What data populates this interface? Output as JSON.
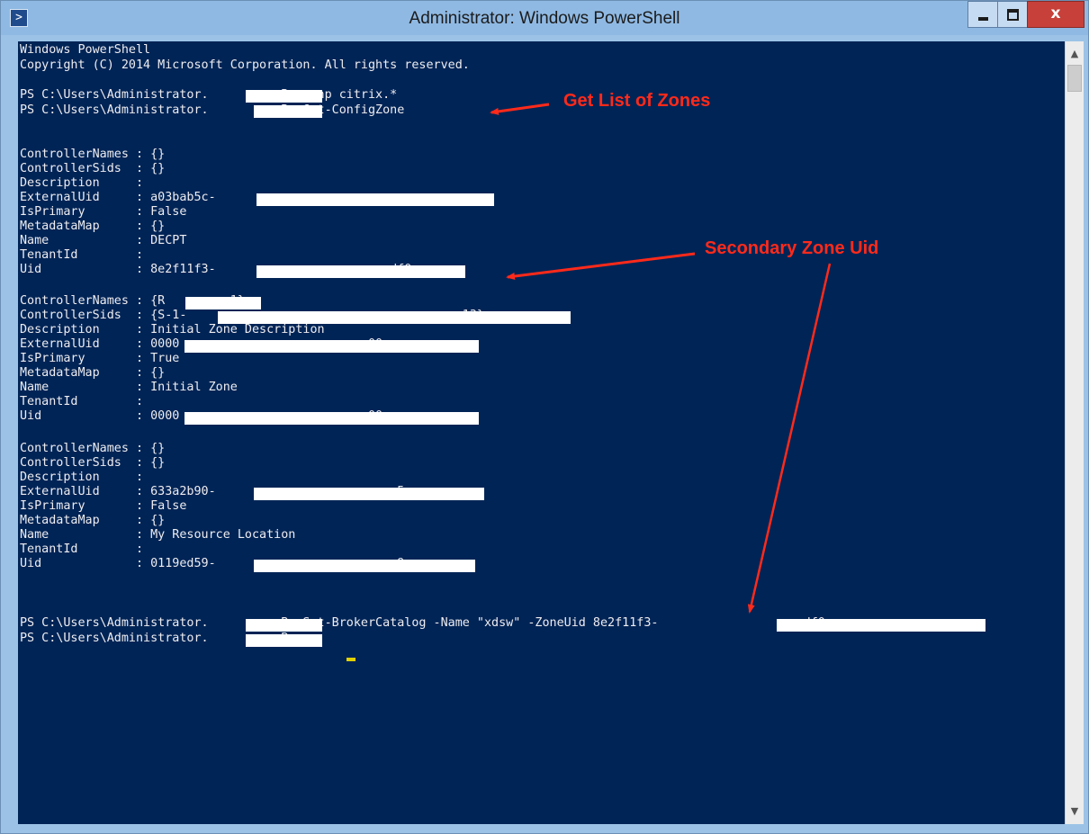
{
  "window": {
    "title": "Administrator: Windows PowerShell",
    "close_label": "x"
  },
  "console": {
    "banner1": "Windows PowerShell",
    "banner2": "Copyright (C) 2014 Microsoft Corporation. All rights reserved.",
    "cmd1": "PS C:\\Users\\Administrator.          B> asnp citrix.*",
    "cmd2": "PS C:\\Users\\Administrator.          B> Get-ConfigZone",
    "zones": [
      {
        "controller_names": "ControllerNames : {}",
        "controller_sids": "ControllerSids  : {}",
        "description": "Description     :",
        "external_uid": "ExternalUid     : a03bab5c-",
        "is_primary": "IsPrimary       : False",
        "metadata_map": "MetadataMap     : {}",
        "name": "Name            : DECPT",
        "tenant_id": "TenantId        :",
        "uid": "Uid             : 8e2f11f3-                        df0"
      },
      {
        "controller_names": "ControllerNames : {R        -1}",
        "controller_sids": "ControllerSids  : {S-1-                                      13}",
        "description": "Description     : Initial Zone Description",
        "external_uid": "ExternalUid     : 0000                          00",
        "is_primary": "IsPrimary       : True",
        "metadata_map": "MetadataMap     : {}",
        "name": "Name            : Initial Zone",
        "tenant_id": "TenantId        :",
        "uid": "Uid             : 0000                          00"
      },
      {
        "controller_names": "ControllerNames : {}",
        "controller_sids": "ControllerSids  : {}",
        "description": "Description     :",
        "external_uid": "ExternalUid     : 633a2b90-                         5",
        "is_primary": "IsPrimary       : False",
        "metadata_map": "MetadataMap     : {}",
        "name": "Name            : My Resource Location",
        "tenant_id": "TenantId        :",
        "uid": "Uid             : 0119ed59-                         9e"
      }
    ],
    "cmd3": "PS C:\\Users\\Administrator.          B> Set-BrokerCatalog -Name \"xdsw\" -ZoneUid 8e2f11f3-                    df0",
    "prompt": "PS C:\\Users\\Administrator.          B> "
  },
  "annotations": {
    "get_list": "Get List of Zones",
    "secondary_uid": "Secondary Zone Uid",
    "color": "#ff2a1a"
  },
  "colors": {
    "console_bg": "#012456",
    "console_text": "#eeedf0",
    "titlebar": "#8fb9e3",
    "close_button": "#c7403a"
  }
}
